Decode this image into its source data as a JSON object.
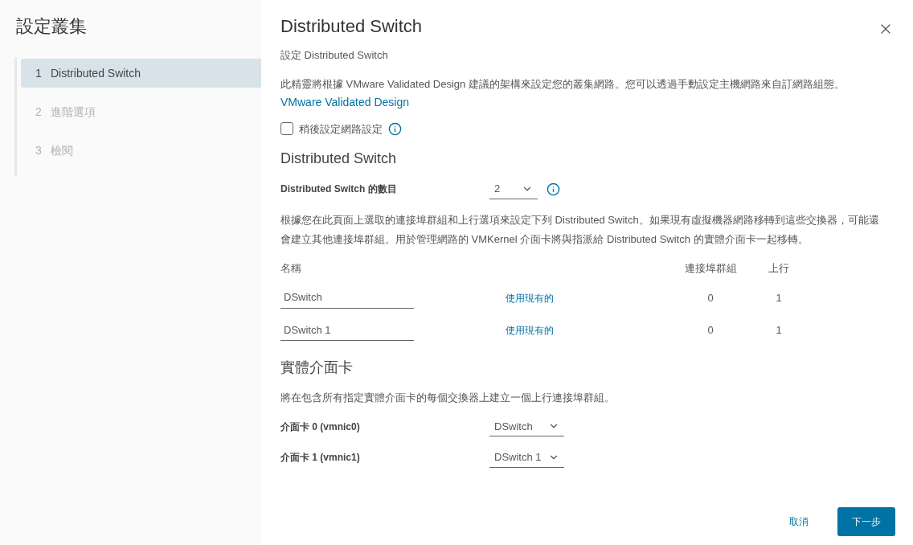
{
  "sidebar": {
    "title": "設定叢集",
    "steps": [
      {
        "number": "1",
        "label": "Distributed Switch",
        "selected": true,
        "disabled": false
      },
      {
        "number": "2",
        "label": "進階選項",
        "selected": false,
        "disabled": true
      },
      {
        "number": "3",
        "label": "檢閱",
        "selected": false,
        "disabled": true
      }
    ]
  },
  "dialog": {
    "title": "Distributed Switch",
    "subtitle": "設定 Distributed Switch",
    "intro": "此精靈將根據 VMware Validated Design 建議的架構來設定您的叢集網路。您可以透過手動設定主機網路來自訂網路組態。",
    "intro_link": "VMware Validated Design",
    "later_checkbox": {
      "label": "稍後設定網路設定",
      "checked": false
    },
    "switch_section": {
      "heading": "Distributed Switch",
      "count_label": "Distributed Switch 的數目",
      "count_value": "2",
      "description": "根據您在此頁面上選取的連接埠群組和上行選項來設定下列 Distributed Switch。如果現有虛擬機器網路移轉到這些交換器，可能還會建立其他連接埠群組。用於管理網路的 VMKernel 介面卡將與指派給 Distributed Switch 的實體介面卡一起移轉。",
      "columns": [
        "名稱",
        "連接埠群組",
        "上行"
      ],
      "rows": [
        {
          "name": "DSwitch",
          "action": "使用現有的",
          "port_groups": "0",
          "uplinks": "1"
        },
        {
          "name": "DSwitch 1",
          "action": "使用現有的",
          "port_groups": "0",
          "uplinks": "1"
        }
      ]
    },
    "nic_section": {
      "heading": "實體介面卡",
      "description": "將在包含所有指定實體介面卡的每個交換器上建立一個上行連接埠群組。",
      "nics": [
        {
          "label": "介面卡 0 (vmnic0)",
          "value": "DSwitch"
        },
        {
          "label": "介面卡 1 (vmnic1)",
          "value": "DSwitch 1"
        }
      ]
    },
    "buttons": {
      "cancel": "取消",
      "next": "下一步"
    }
  }
}
